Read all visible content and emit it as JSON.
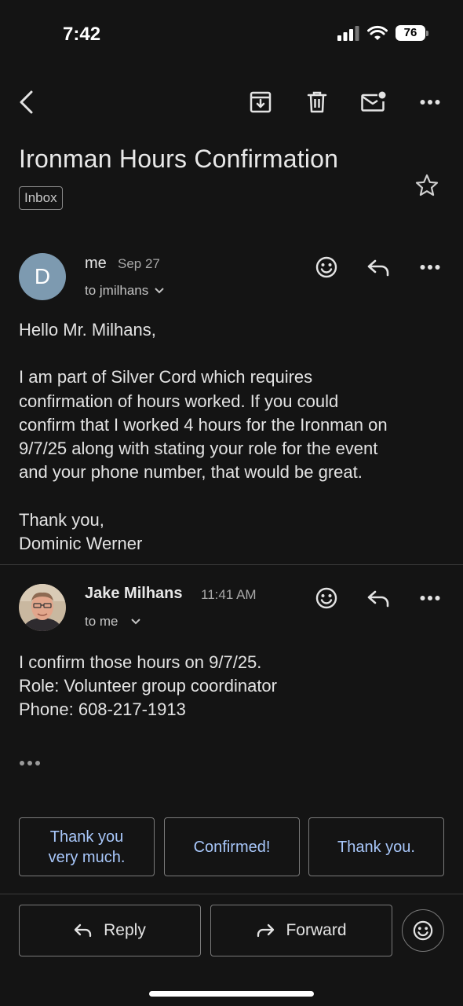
{
  "status_bar": {
    "time": "7:42",
    "battery": "76"
  },
  "toolbar": {
    "back_icon": "back-arrow-icon",
    "archive_icon": "archive-icon",
    "delete_icon": "trash-icon",
    "mark_unread_icon": "mark-unread-icon",
    "more_icon": "more-horizontal-icon"
  },
  "subject": "Ironman Hours Confirmation",
  "label": "Inbox",
  "messages": [
    {
      "avatar_letter": "D",
      "avatar_color": "#7d9ab0",
      "sender": "me",
      "date": "Sep 27",
      "recipient": "to jmilhans",
      "body": [
        "Hello Mr. Milhans,",
        "",
        "I am part of Silver Cord which requires",
        "confirmation of hours worked. If you could",
        "confirm that I worked 4 hours for the Ironman on",
        "9/7/25 along with stating your role for the event",
        "and your phone number, that would be great.",
        "",
        "Thank you,",
        "Dominic Werner"
      ]
    },
    {
      "sender": "Jake Milhans",
      "date": "11:41 AM",
      "recipient": "to me",
      "body": [
        "I confirm those hours on 9/7/25.",
        "Role: Volunteer group coordinator",
        "Phone: 608-217-1913"
      ]
    }
  ],
  "smart_replies": [
    {
      "line1": "Thank you",
      "line2": "very much."
    },
    {
      "line1": "Confirmed!",
      "line2": ""
    },
    {
      "line1": "Thank you.",
      "line2": ""
    }
  ],
  "actions": {
    "reply": "Reply",
    "forward": "Forward"
  },
  "colors": {
    "background": "#141414",
    "accent_text": "#a8c7fa",
    "border": "#7a7a7a"
  }
}
